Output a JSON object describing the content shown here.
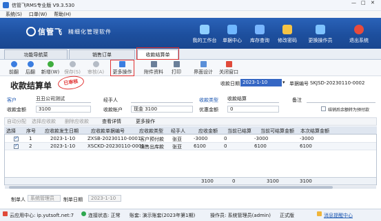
{
  "window": {
    "title": "信管飞RMS专业版 V9.3.530",
    "min": "—",
    "max": "□",
    "close": "✕"
  },
  "menu": [
    "系统(S)",
    "口单(W)",
    "帮助(H)"
  ],
  "brand": {
    "name": "信管飞",
    "tagline": "精细化管理软件"
  },
  "topbuttons": [
    {
      "label": "我的工作台",
      "icon": "monitor-icon",
      "color": "#8fd0ff"
    },
    {
      "label": "单据中心",
      "icon": "document-icon",
      "color": "#6fb7ff"
    },
    {
      "label": "库存查询",
      "icon": "warehouse-icon",
      "color": "#79b6ff"
    },
    {
      "label": "修改密码",
      "icon": "lock-icon",
      "color": "#f6c445"
    },
    {
      "label": "更换操作员",
      "icon": "users-icon",
      "color": "#7ec2ff"
    },
    {
      "label": "退出系统",
      "icon": "power-icon",
      "color": "#e84b3c"
    }
  ],
  "tabs": [
    {
      "label": "功能导航菜",
      "active": false
    },
    {
      "label": "销售订单",
      "active": false
    },
    {
      "label": "收款结算单",
      "active": true
    }
  ],
  "toolbar": [
    {
      "label": "前翻",
      "icon": "arrow-left-icon",
      "enabled": true
    },
    {
      "label": "后翻",
      "icon": "arrow-right-icon",
      "enabled": true
    },
    {
      "label": "新增(W)",
      "icon": "add-icon",
      "enabled": true
    },
    {
      "label": "保存(S)",
      "icon": "save-icon",
      "enabled": false
    },
    {
      "label": "审核(A)",
      "icon": "approve-icon",
      "enabled": false
    },
    {
      "label": "更多操作",
      "icon": "more-icon",
      "enabled": true
    },
    {
      "label": "附件资料",
      "icon": "attachment-icon",
      "enabled": true
    },
    {
      "label": "打印",
      "icon": "print-icon",
      "enabled": true
    },
    {
      "label": "界面设计",
      "icon": "design-icon",
      "enabled": true
    },
    {
      "label": "关闭窗口",
      "icon": "close-window-icon",
      "enabled": true
    }
  ],
  "form": {
    "title": "收款结算单",
    "stamp": "已审核",
    "date_label": "收款日期",
    "date_value": "2023-1-10",
    "billno_label": "单据编号",
    "billno_value": "SKJSD-20230110-0002",
    "customer_label": "客户",
    "customer_value": "丑丑公司测试",
    "handler_label": "经手人",
    "handler_value": "",
    "type_label": "收款类型",
    "type_value": "收款结算",
    "note_label": "备注",
    "note_value": "",
    "amount_label": "收款金额",
    "amount_value": "3100",
    "account_label": "收款帐户",
    "account_value": "现金 3100",
    "discount_label": "优惠金额",
    "discount_value": "0",
    "carry_label": "结销后余额转为预付款"
  },
  "gridtools": [
    {
      "label": "自动分配",
      "enabled": false
    },
    {
      "label": "选择应收款",
      "enabled": false
    },
    {
      "label": "删除应收款",
      "enabled": false
    },
    {
      "label": "查看详情",
      "enabled": true
    },
    {
      "label": "更多操作",
      "enabled": true
    }
  ],
  "grid": {
    "columns": [
      "选择",
      "序号",
      "应收款发生日期",
      "应收款单据编号",
      "应收款类型",
      "经手人",
      "应收金额",
      "当前已结算",
      "当前可结算金额",
      "本次结算金额"
    ],
    "rows": [
      {
        "selected": true,
        "no": "1",
        "date": "2023-1-10",
        "billno": "ZXSB-20230110-0001",
        "type": "客户预付款",
        "handler": "张亚",
        "amount": "-3000",
        "settled": "0",
        "available": "-3000",
        "current": "-3000"
      },
      {
        "selected": true,
        "no": "2",
        "date": "2023-1-10",
        "billno": "XSCKD-20230110-0001",
        "type": "销售出库款",
        "handler": "张亚",
        "amount": "6100",
        "settled": "0",
        "available": "6100",
        "current": "6100"
      }
    ],
    "totals": {
      "amount": "3100",
      "settled": "0",
      "available": "3100",
      "current": "3100"
    }
  },
  "footer": {
    "maker_label": "制单人",
    "maker_value": "系统管理员",
    "makedate_label": "制单日期",
    "makedate_value": "2023-1-10"
  },
  "status": {
    "cloud": "云应用中心: ip.yutsoft.net:7",
    "conn": "连接状态: 正常",
    "account": "账套: 演示账套(2023年第1期)",
    "operator": "操作员: 系统管理员(admin)",
    "version": "正式版",
    "notify": "消息提醒中心"
  }
}
